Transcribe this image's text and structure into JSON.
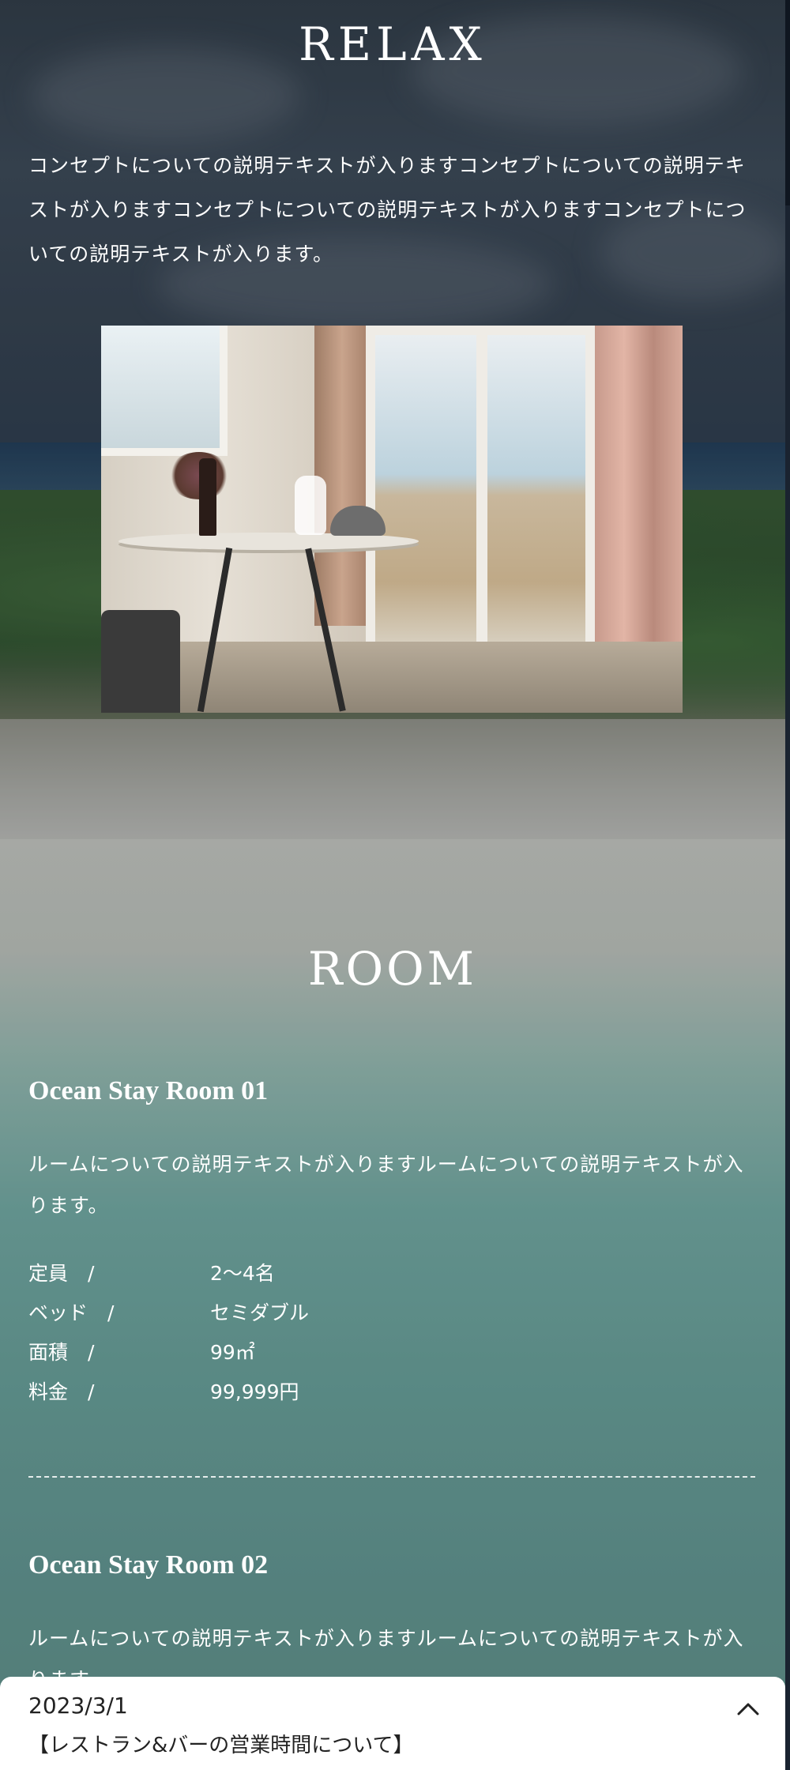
{
  "relax": {
    "title": "RELAX",
    "text": "コンセプトについての説明テキストが入りますコンセプトについての説明テキストが入りますコンセプトについての説明テキストが入りますコンセプトについての説明テキストが入ります。"
  },
  "room": {
    "title": "ROOM",
    "rooms": [
      {
        "name": "Ocean Stay Room 01",
        "description": "ルームについての説明テキストが入りますルームについての説明テキストが入ります。",
        "specs": [
          {
            "label": "定員　/",
            "value": "2〜4名"
          },
          {
            "label": "ベッド　/",
            "value": "セミダブル"
          },
          {
            "label": "面積　/",
            "value": "99㎡"
          },
          {
            "label": "料金　/",
            "value": "99,999円"
          }
        ]
      },
      {
        "name": "Ocean Stay Room 02",
        "description": "ルームについての説明テキストが入りますルームについての説明テキストが入ります。"
      }
    ]
  },
  "news": {
    "date": "2023/3/1",
    "title": "【レストラン&バーの営業時間について】",
    "toggle_icon": "chevron-up-icon"
  }
}
